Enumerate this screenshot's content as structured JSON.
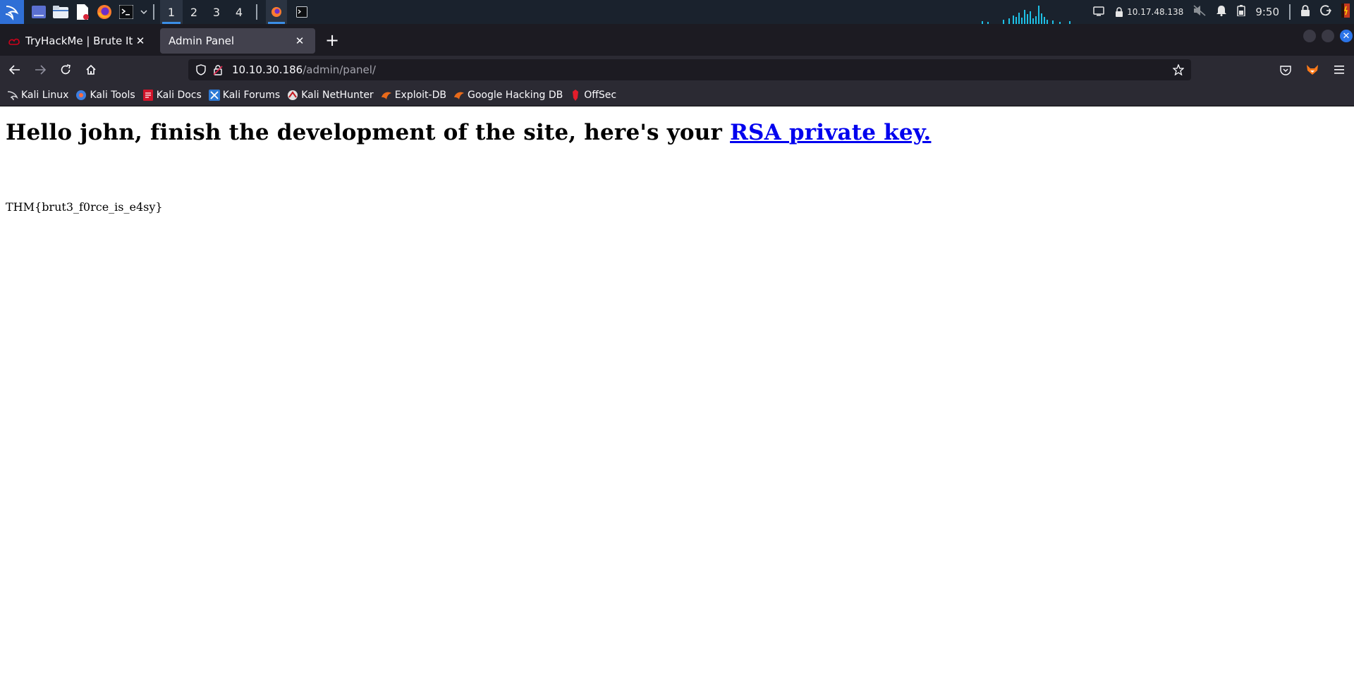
{
  "taskbar": {
    "workspaces": [
      "1",
      "2",
      "3",
      "4"
    ],
    "active_workspace": "1",
    "ip": "10.17.48.138",
    "clock": "9:50"
  },
  "browser": {
    "tabs": [
      {
        "title": "TryHackMe | Brute It",
        "favicon": "thm-icon",
        "active": false
      },
      {
        "title": "Admin Panel",
        "favicon": "",
        "active": true
      }
    ],
    "url_host": "10.10.30.186",
    "url_path": "/admin/panel/",
    "bookmarks": [
      {
        "label": "Kali Linux",
        "icon": "kali-dragon-icon"
      },
      {
        "label": "Kali Tools",
        "icon": "kali-tools-icon"
      },
      {
        "label": "Kali Docs",
        "icon": "kali-docs-icon"
      },
      {
        "label": "Kali Forums",
        "icon": "kali-forums-icon"
      },
      {
        "label": "Kali NetHunter",
        "icon": "nethunter-icon"
      },
      {
        "label": "Exploit-DB",
        "icon": "exploit-db-icon"
      },
      {
        "label": "Google Hacking DB",
        "icon": "ghdb-icon"
      },
      {
        "label": "OffSec",
        "icon": "offsec-icon"
      }
    ]
  },
  "page": {
    "heading_text": "Hello john, finish the development of the site, here's your ",
    "heading_link": "RSA private key.",
    "flag": "THM{brut3_f0rce_is_e4sy}"
  },
  "colors": {
    "link": "#0000ee",
    "accent": "#3b8ee6",
    "taskbar_bg": "#1a222d",
    "browser_chrome": "#2b2a33"
  }
}
